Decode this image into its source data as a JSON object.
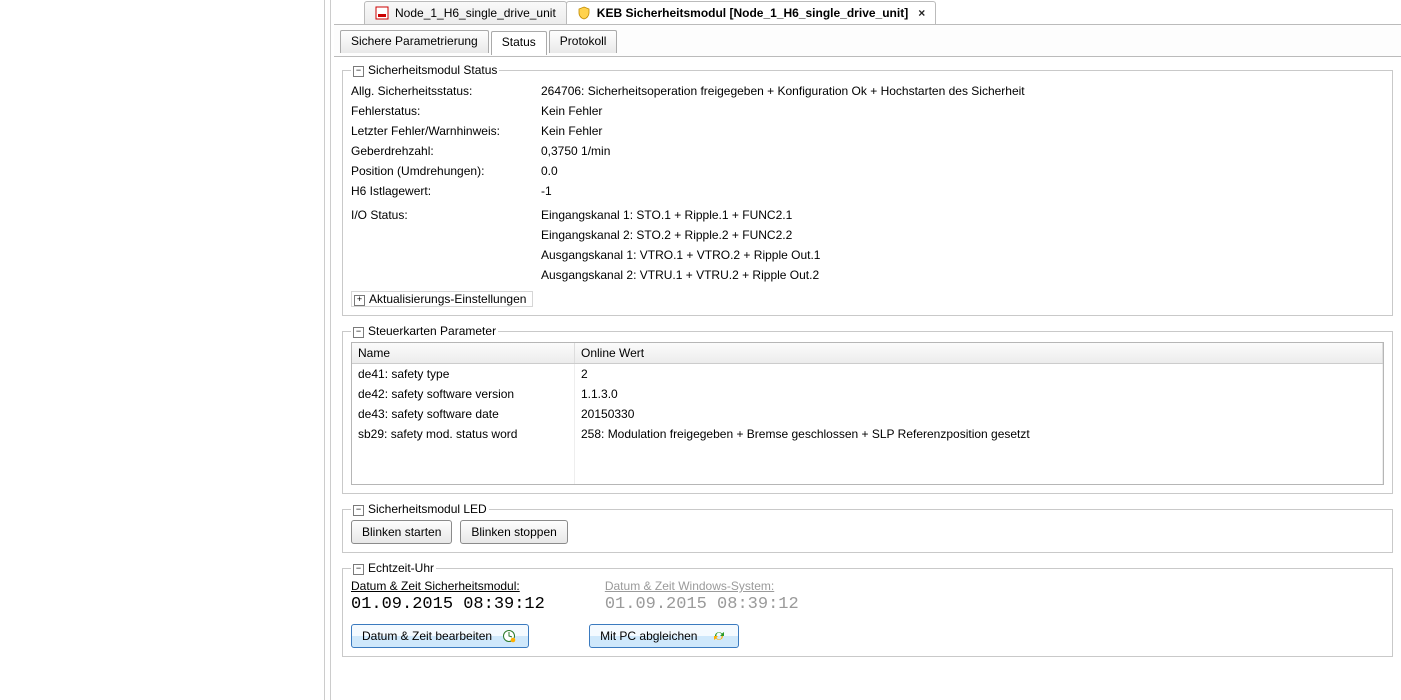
{
  "doc_tabs": {
    "inactive": "Node_1_H6_single_drive_unit",
    "active": "KEB Sicherheitsmodul [Node_1_H6_single_drive_unit]"
  },
  "inner_tabs": {
    "t1": "Sichere Parametrierung",
    "t2": "Status",
    "t3": "Protokoll"
  },
  "status_group": {
    "legend": "Sicherheitsmodul Status",
    "rows": {
      "allg_label": "Allg. Sicherheitsstatus:",
      "allg_value": "264706: Sicherheitsoperation freigegeben + Konfiguration Ok + Hochstarten des Sicherheit",
      "fehler_label": "Fehlerstatus:",
      "fehler_value": "Kein Fehler",
      "last_label": "Letzter Fehler/Warnhinweis:",
      "last_value": "Kein Fehler",
      "geber_label": "Geberdrehzahl:",
      "geber_value": "0,3750 1/min",
      "pos_label": "Position (Umdrehungen):",
      "pos_value": "0.0",
      "h6_label": "H6 Istlagewert:",
      "h6_value": "-1",
      "io_label": "I/O Status:",
      "io_line1": "Eingangskanal 1: STO.1 + Ripple.1 + FUNC2.1",
      "io_line2": "Eingangskanal 2: STO.2 + Ripple.2 + FUNC2.2",
      "io_line3": "Ausgangskanal 1: VTRO.1 + VTRO.2 + Ripple Out.1",
      "io_line4": "Ausgangskanal 2: VTRU.1 + VTRU.2 + Ripple Out.2"
    },
    "refresh_legend": "Aktualisierungs-Einstellungen"
  },
  "params_group": {
    "legend": "Steuerkarten Parameter",
    "headers": {
      "name": "Name",
      "value": "Online Wert"
    },
    "rows": [
      {
        "name": "de41: safety type",
        "value": "2"
      },
      {
        "name": "de42: safety software version",
        "value": "1.1.3.0"
      },
      {
        "name": "de43: safety software date",
        "value": "20150330"
      },
      {
        "name": "sb29: safety mod. status word",
        "value": "258: Modulation freigegeben + Bremse geschlossen + SLP Referenzposition gesetzt"
      }
    ]
  },
  "led_group": {
    "legend": "Sicherheitsmodul LED",
    "start_btn": "Blinken starten",
    "stop_btn": "Blinken stoppen"
  },
  "rtc_group": {
    "legend": "Echtzeit-Uhr",
    "mod_head": "Datum & Zeit Sicherheitsmodul:",
    "mod_time": "01.09.2015 08:39:12",
    "win_head": "Datum & Zeit Windows-System:",
    "win_time": "01.09.2015 08:39:12",
    "edit_btn": "Datum & Zeit bearbeiten",
    "sync_btn": "Mit PC abgleichen"
  }
}
